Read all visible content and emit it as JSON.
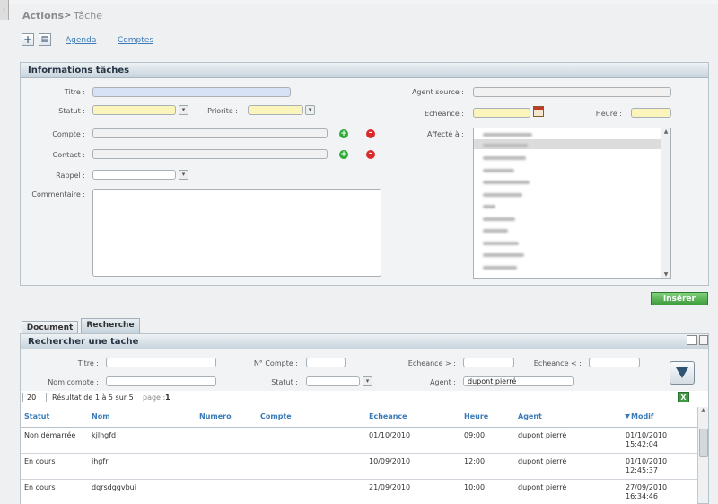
{
  "breadcrumb": {
    "root": "Actions",
    "separator": ">",
    "current": "Tâche"
  },
  "toolbar": {
    "add_icon": "plus-icon",
    "view_icon": "page-icon",
    "links": [
      "Agenda",
      "Comptes"
    ]
  },
  "info_panel": {
    "title": "Informations tâches",
    "labels": {
      "titre": "Titre :",
      "statut": "Statut :",
      "priorite": "Priorite :",
      "compte": "Compte :",
      "contact": "Contact :",
      "rappel": "Rappel :",
      "commentaire": "Commentaire :",
      "agent_source": "Agent source :",
      "echeance": "Echeance :",
      "heure": "Heure :",
      "affecte": "Affecté à :"
    },
    "insert_button": "insérer"
  },
  "tabs": [
    "Document",
    "Recherche"
  ],
  "search_panel": {
    "title": "Rechercher une tache",
    "labels": {
      "titre": "Titre :",
      "n_compte": "N° Compte :",
      "echeance_gt": "Echeance > :",
      "echeance_lt": "Echeance < :",
      "nom_compte": "Nom compte :",
      "statut": "Statut :",
      "agent": "Agent :"
    },
    "agent_value": "dupont pierré"
  },
  "results": {
    "page_size": "20",
    "summary": "Résultat de 1 à 5 sur 5",
    "page_label": "page :",
    "page_number": "1",
    "columns": [
      "Statut",
      "Nom",
      "Numero",
      "Compte",
      "Echeance",
      "Heure",
      "Agent",
      "Modif"
    ],
    "rows": [
      {
        "statut": "Non démarrée",
        "nom": "kjlhgfd",
        "numero": "",
        "compte": "",
        "echeance": "01/10/2010",
        "heure": "09:00",
        "agent": "dupont pierré",
        "modif_date": "01/10/2010",
        "modif_time": "15:42:04"
      },
      {
        "statut": "En cours",
        "nom": "jhgfr",
        "numero": "",
        "compte": "",
        "echeance": "10/09/2010",
        "heure": "12:00",
        "agent": "dupont pierré",
        "modif_date": "01/10/2010",
        "modif_time": "12:45:37"
      },
      {
        "statut": "En cours",
        "nom": "dqrsdggvbui",
        "numero": "",
        "compte": "",
        "echeance": "21/09/2010",
        "heure": "10:00",
        "agent": "dupont pierré",
        "modif_date": "27/09/2010",
        "modif_time": "16:34:46"
      }
    ]
  },
  "colors": {
    "accent": "#3a7ab8",
    "required_field": "#fbf5bb",
    "title_field": "#d7e2f7",
    "insert_button": "#4fae4b"
  }
}
